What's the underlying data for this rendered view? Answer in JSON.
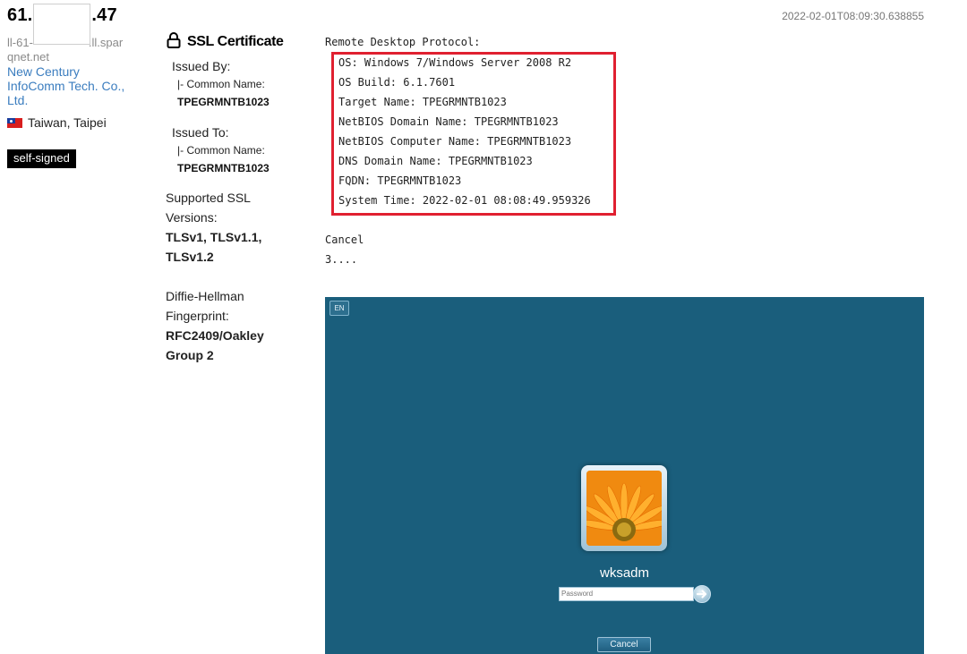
{
  "host": {
    "ip_prefix": "61.",
    "ip_suffix": ".47",
    "hostname_part1": "ll-61-",
    "hostname_part2": ".ll.spar",
    "hostname_part3": "qnet.net",
    "organization": "New Century InfoComm Tech. Co., Ltd.",
    "location": "Taiwan, Taipei",
    "flag_icon": "taiwan-flag-icon",
    "tag": "self-signed"
  },
  "ssl": {
    "title": "SSL Certificate",
    "icon": "lock-icon",
    "issued_by_label": "Issued By:",
    "issued_by_cn_label": "|- Common Name:",
    "issued_by_cn_value": "TPEGRMNTB1023",
    "issued_to_label": "Issued To:",
    "issued_to_cn_label": "|- Common Name:",
    "issued_to_cn_value": "TPEGRMNTB1023",
    "versions_label_1": "Supported SSL",
    "versions_label_2": "Versions:",
    "versions_value_1": "TLSv1, TLSv1.1,",
    "versions_value_2": "TLSv1.2",
    "dh_label_1": "Diffie-Hellman",
    "dh_label_2": "Fingerprint:",
    "dh_value_1": "RFC2409/Oakley",
    "dh_value_2": "Group 2"
  },
  "scan": {
    "timestamp": "2022-02-01T08:09:30.638855",
    "protocol_label": "Remote Desktop Protocol:",
    "lines": [
      "OS: Windows 7/Windows Server 2008 R2",
      "OS Build: 6.1.7601",
      "Target Name: TPEGRMNTB1023",
      "NetBIOS Domain Name: TPEGRMNTB1023",
      "NetBIOS Computer Name: TPEGRMNTB1023",
      "DNS Domain Name: TPEGRMNTB1023",
      "FQDN: TPEGRMNTB1023",
      "System Time: 2022-02-01 08:08:49.959326"
    ],
    "cancel_text": "Cancel",
    "dots_text": "3...."
  },
  "rdp_screen": {
    "lang": "EN",
    "username": "wksadm",
    "password_placeholder": "Password",
    "cancel_label": "Cancel",
    "bg_color": "#1a5e7c"
  }
}
